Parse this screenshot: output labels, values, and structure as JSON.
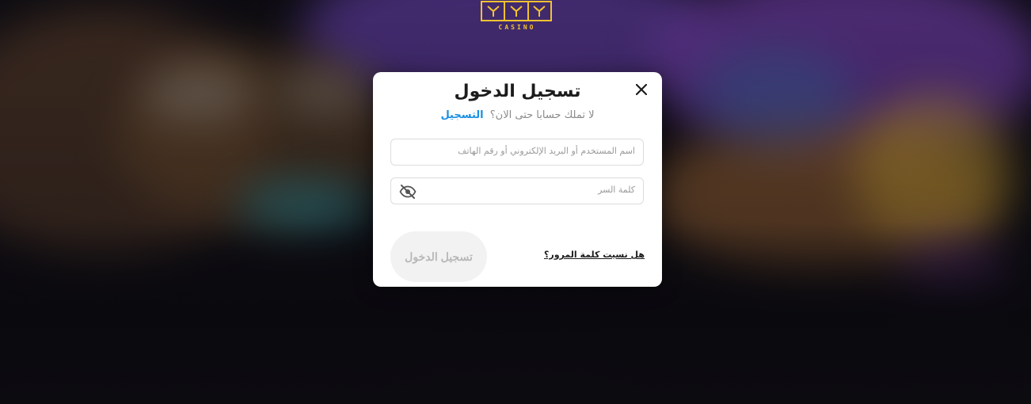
{
  "logo": {
    "text": "CASINO",
    "color": "#f2c230"
  },
  "modal": {
    "title": "تسجيل الدخول",
    "subtitle_text": "لا تملك حسابا حتى الان؟",
    "register_link": "التسجيل",
    "username_placeholder": "اسم المستخدم أو البريد الإلكتروني أو رقم الهاتف",
    "password_placeholder": "كلمة السر",
    "forgot_password": "هل نسيت كلمة المرور؟",
    "login_button": "تسجيل الدخول",
    "close_icon": "close-icon",
    "password_toggle_icon": "eye-off-icon",
    "accent_color": "#1a8fe3"
  }
}
